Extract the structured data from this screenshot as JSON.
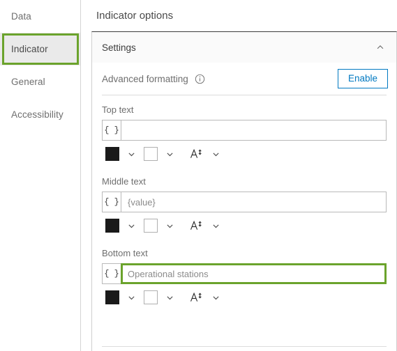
{
  "sidebar": {
    "items": [
      {
        "label": "Data",
        "selected": false
      },
      {
        "label": "Indicator",
        "selected": true
      },
      {
        "label": "General",
        "selected": false
      },
      {
        "label": "Accessibility",
        "selected": false
      }
    ]
  },
  "header": {
    "title": "Indicator options"
  },
  "panel": {
    "settings_title": "Settings",
    "collapse_icon": "chevron-up-icon",
    "advanced_formatting": {
      "label": "Advanced formatting",
      "info_icon": "info-circle-icon",
      "enable_label": "Enable"
    },
    "fields": [
      {
        "label": "Top text",
        "expression_button": "{ }",
        "value": "",
        "placeholder": "",
        "highlighted": false,
        "text_color_swatch": "#1a1a1a",
        "background_color_swatch": "#ffffff",
        "font_size_icon": "font-size-icon"
      },
      {
        "label": "Middle text",
        "expression_button": "{ }",
        "value": "{value}",
        "placeholder": "",
        "highlighted": false,
        "text_color_swatch": "#1a1a1a",
        "background_color_swatch": "#ffffff",
        "font_size_icon": "font-size-icon"
      },
      {
        "label": "Bottom text",
        "expression_button": "{ }",
        "value": "Operational stations",
        "placeholder": "",
        "highlighted": true,
        "text_color_swatch": "#1a1a1a",
        "background_color_swatch": "#ffffff",
        "font_size_icon": "font-size-icon"
      }
    ]
  },
  "colors": {
    "annotation_green": "#6ba32c",
    "accent_blue": "#0079c1",
    "selected_background": "#eaeaea"
  }
}
